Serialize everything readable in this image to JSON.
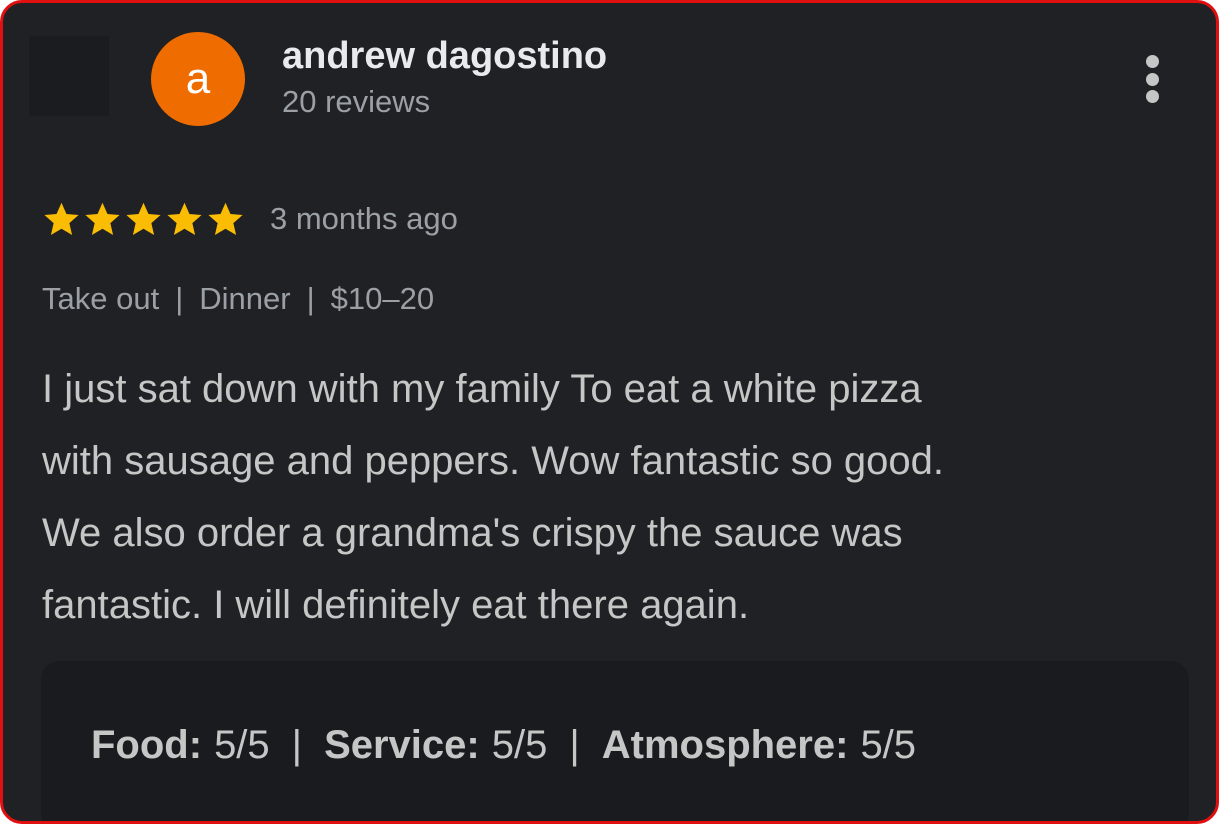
{
  "reviewer": {
    "avatar_letter": "a",
    "avatar_color": "#ef6c00",
    "name": "andrew dagostino",
    "review_count": "20 reviews"
  },
  "menu": {
    "icon": "more-vert-icon"
  },
  "rating": {
    "stars": 5,
    "max_stars": 5,
    "star_color": "#fbbc04",
    "time_ago": "3 months ago"
  },
  "meta": {
    "service_type": "Take out",
    "meal_type": "Dinner",
    "price_range": "$10–20",
    "separator": "|"
  },
  "review": {
    "lines": [
      "I just sat down with my family To eat a white pizza",
      "with sausage and peppers. Wow fantastic so good.",
      "We also order a grandma's crispy the sauce was",
      "fantastic. I will definitely eat there again."
    ]
  },
  "subratings": {
    "separator": "|",
    "items": [
      {
        "label": "Food:",
        "value": "5/5"
      },
      {
        "label": "Service:",
        "value": "5/5"
      },
      {
        "label": "Atmosphere:",
        "value": "5/5"
      }
    ]
  },
  "colors": {
    "card_background": "#202124",
    "border": "#e01010",
    "primary_text": "#e8eaed",
    "secondary_text": "#9aa0a6"
  }
}
